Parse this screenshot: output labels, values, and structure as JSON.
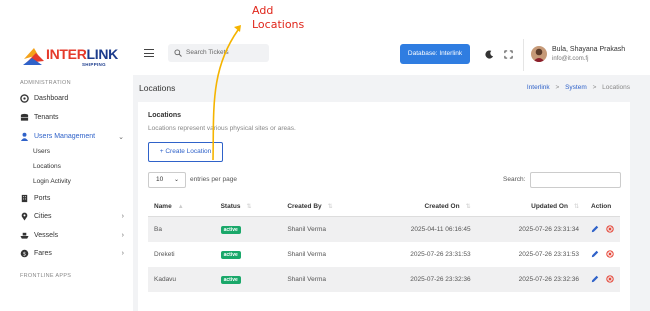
{
  "annotation": {
    "line1": "Add",
    "line2": "Locations"
  },
  "logo": {
    "brand_part1": "INTER",
    "brand_part2": "LINK",
    "tagline": "SHIPPING"
  },
  "sidebar": {
    "section_admin": "ADMINISTRATION",
    "items": [
      {
        "label": "Dashboard",
        "icon": "dashboard-icon"
      },
      {
        "label": "Tenants",
        "icon": "database-icon"
      },
      {
        "label": "Users Management",
        "icon": "user-icon"
      },
      {
        "label": "Ports",
        "icon": "building-icon"
      },
      {
        "label": "Cities",
        "icon": "map-pin-icon"
      },
      {
        "label": "Vessels",
        "icon": "ship-icon"
      },
      {
        "label": "Fares",
        "icon": "dollar-icon"
      }
    ],
    "sub_items": [
      "Users",
      "Locations",
      "Login Activity"
    ],
    "section_frontline": "FRONTLINE APPS"
  },
  "topbar": {
    "search_placeholder": "Search Tickets",
    "database_button": "Database: Interlink",
    "user_name": "Bula, Shayana Prakash",
    "user_email": "info@it.com.fj"
  },
  "page": {
    "title": "Locations",
    "breadcrumb": [
      "Interlink",
      "System",
      "Locations"
    ]
  },
  "card": {
    "title": "Locations",
    "description": "Locations represent various physical sites or areas.",
    "create_button": "+ Create Location",
    "entries_value": "10",
    "entries_label": "entries per page",
    "search_label": "Search:"
  },
  "table": {
    "headers": [
      "Name",
      "Status",
      "Created By",
      "Created On",
      "Updated On",
      "Action"
    ],
    "rows": [
      {
        "name": "Ba",
        "status": "active",
        "created_by": "Shanil Verma",
        "created_on": "2025-04-11 06:16:45",
        "updated_on": "2025-07-26 23:31:34"
      },
      {
        "name": "Dreketi",
        "status": "active",
        "created_by": "Shanil Verma",
        "created_on": "2025-07-26 23:31:53",
        "updated_on": "2025-07-26 23:31:53"
      },
      {
        "name": "Kadavu",
        "status": "active",
        "created_by": "Shanil Verma",
        "created_on": "2025-07-26 23:32:36",
        "updated_on": "2025-07-26 23:32:36"
      }
    ]
  },
  "colors": {
    "accent": "#2f62c9",
    "primary_button": "#2f7de1",
    "active_badge": "#1aa86a",
    "annotation": "#e0261b",
    "arrow": "#f5b400"
  }
}
